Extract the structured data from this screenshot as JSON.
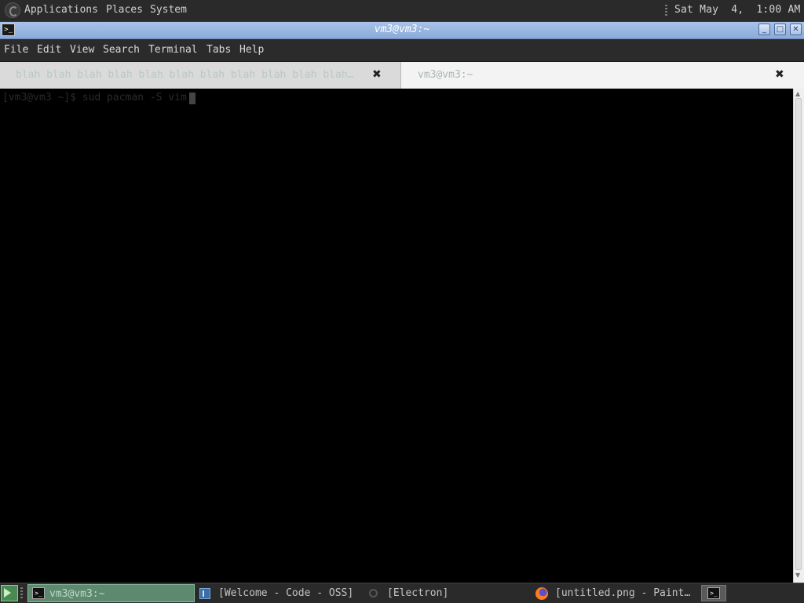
{
  "top_panel": {
    "menus": [
      "Applications",
      "Places",
      "System"
    ],
    "clock": "Sat May  4,  1:00 AM",
    "logo_icon": "distro-logo-icon"
  },
  "window": {
    "title": "vm3@vm3:~",
    "controls": [
      "minimize",
      "maximize",
      "close"
    ],
    "app_icon": "terminal-icon"
  },
  "menubar": {
    "items": [
      "File",
      "Edit",
      "View",
      "Search",
      "Terminal",
      "Tabs",
      "Help"
    ]
  },
  "tabs": [
    {
      "label": "blah blah blah blah blah blah blah blah blah blah blah…",
      "active": false
    },
    {
      "label": "vm3@vm3:~",
      "active": true
    }
  ],
  "terminal": {
    "prompt_line": "[vm3@vm3 ~]$ sud pacman -S vim",
    "background": "#000000"
  },
  "taskbar": {
    "tasks": [
      {
        "label": "vm3@vm3:~",
        "icon": "terminal-icon",
        "active": true
      },
      {
        "label": "[Welcome - Code - OSS]",
        "icon": "code-oss-icon",
        "active": false
      },
      {
        "label": "[Electron]",
        "icon": "electron-icon",
        "active": false
      },
      {
        "label": "[untitled.png - Paint…",
        "icon": "firefox-icon",
        "active": false
      }
    ]
  }
}
